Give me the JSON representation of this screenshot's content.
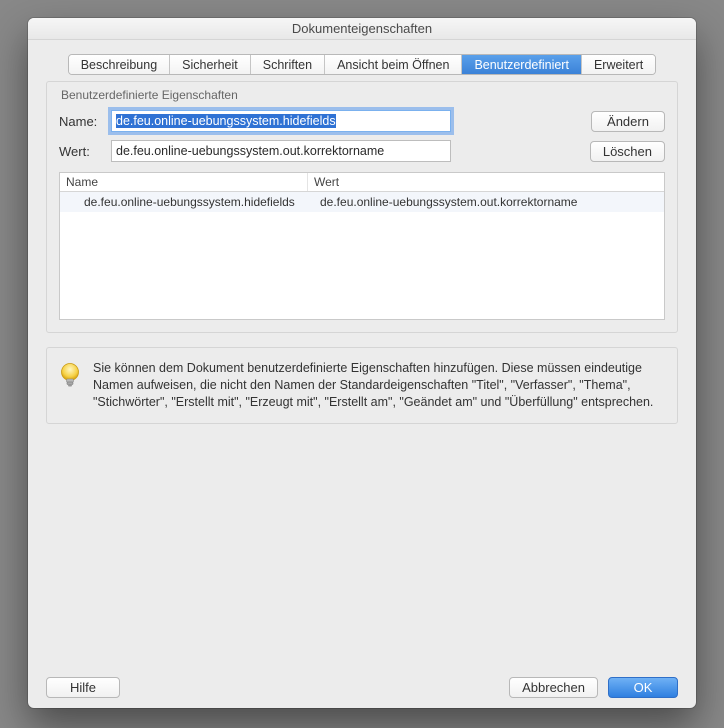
{
  "window": {
    "title": "Dokumenteigenschaften"
  },
  "tabs": {
    "items": [
      {
        "label": "Beschreibung"
      },
      {
        "label": "Sicherheit"
      },
      {
        "label": "Schriften"
      },
      {
        "label": "Ansicht beim Öffnen"
      },
      {
        "label": "Benutzerdefiniert",
        "active": true
      },
      {
        "label": "Erweitert"
      }
    ]
  },
  "group": {
    "legend": "Benutzerdefinierte Eigenschaften",
    "nameLabel": "Name:",
    "wertLabel": "Wert:",
    "nameValue": "de.feu.online-uebungssystem.hidefields",
    "wertValue": "de.feu.online-uebungssystem.out.korrektorname",
    "changeBtn": "Ändern",
    "deleteBtn": "Löschen",
    "table": {
      "headers": {
        "name": "Name",
        "wert": "Wert"
      },
      "rows": [
        {
          "name": "de.feu.online-uebungssystem.hidefields",
          "wert": "de.feu.online-uebungssystem.out.korrektorname"
        }
      ]
    }
  },
  "info": {
    "text": "Sie können dem Dokument benutzerdefinierte Eigenschaften hinzufügen. Diese müssen eindeutige Namen aufweisen, die nicht den Namen der Standardeigenschaften \"Titel\", \"Verfasser\", \"Thema\", \"Stichwörter\", \"Erstellt mit\", \"Erzeugt mit\", \"Erstellt am\",  \"Geändet am\" und \"Überfüllung\" entsprechen."
  },
  "footer": {
    "help": "Hilfe",
    "cancel": "Abbrechen",
    "ok": "OK"
  }
}
